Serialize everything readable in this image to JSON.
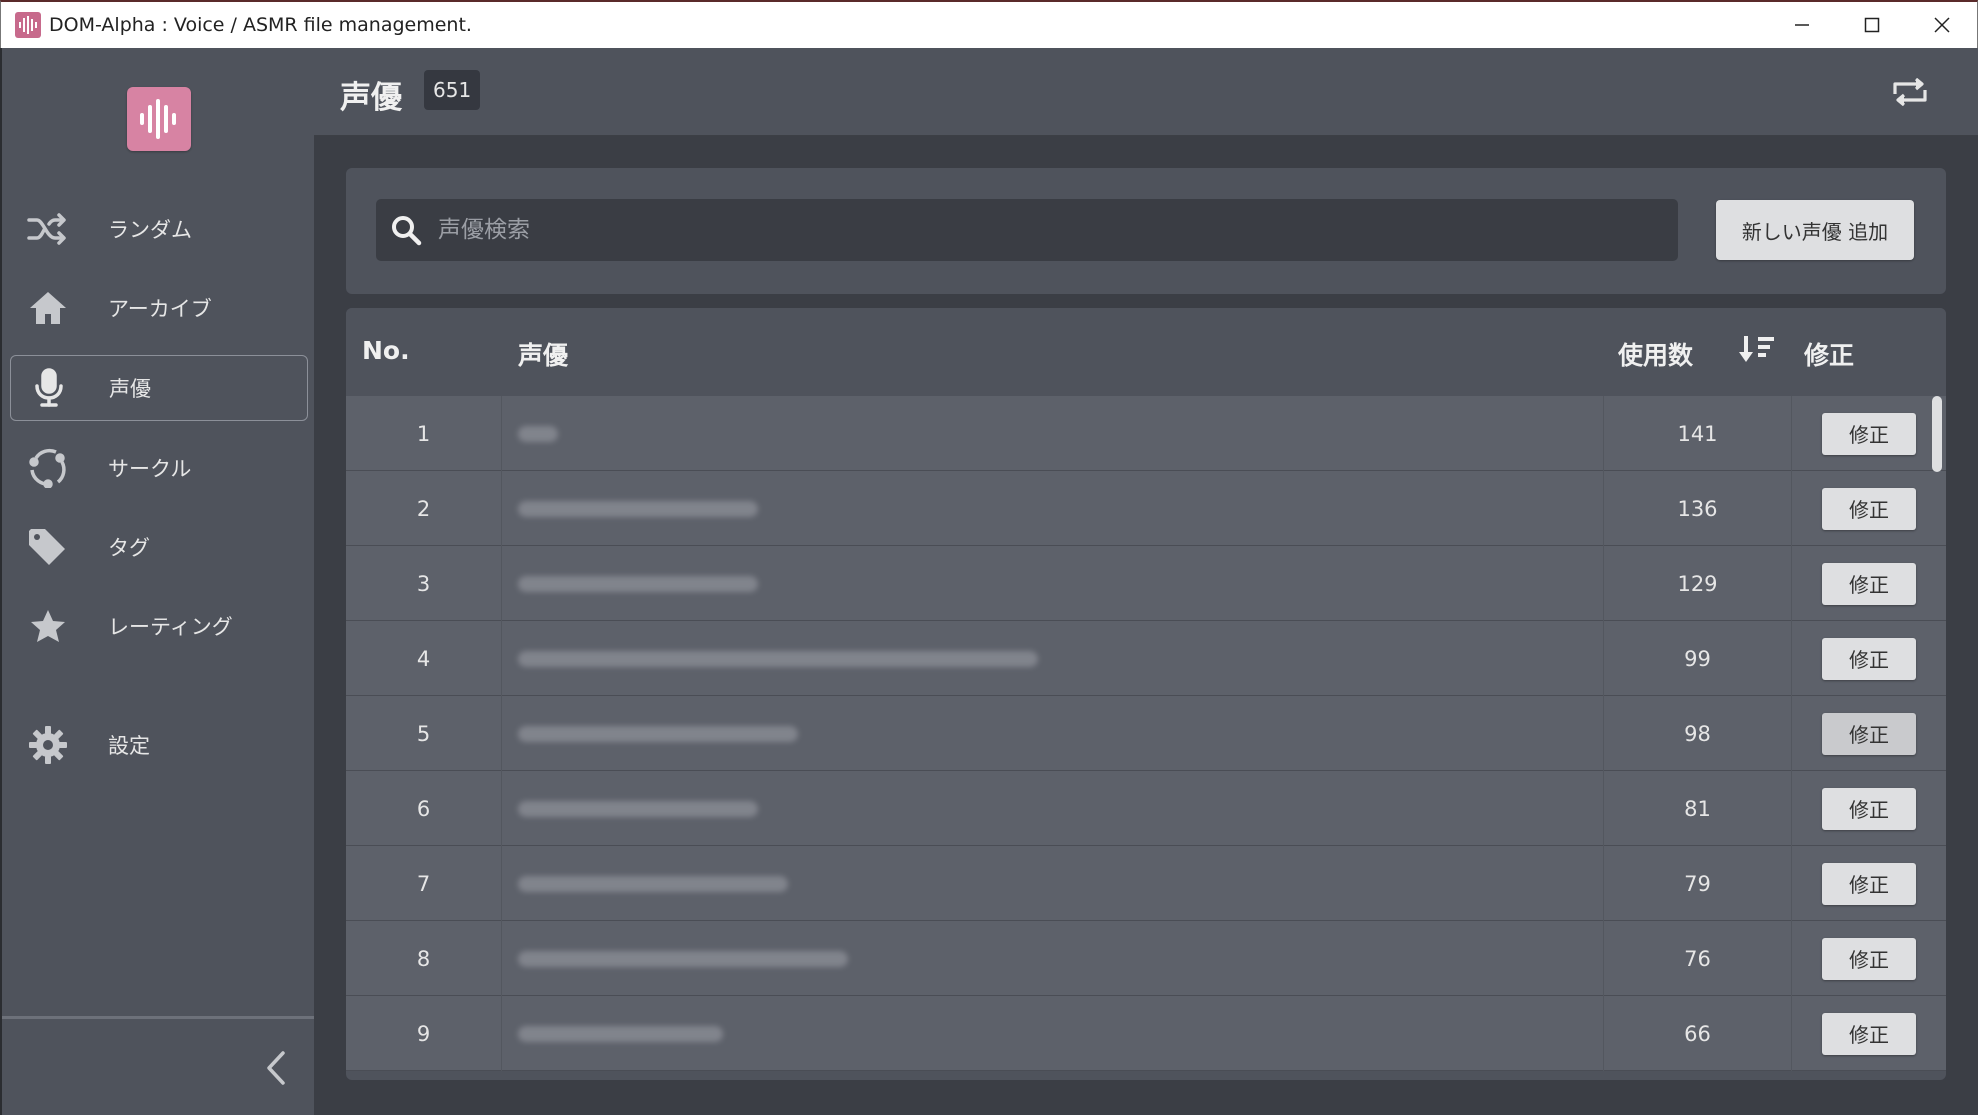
{
  "window": {
    "title": "DOM-Alpha : Voice / ASMR file management."
  },
  "sidebar": {
    "items": [
      {
        "label": "ランダム",
        "icon": "shuffle-icon"
      },
      {
        "label": "アーカイブ",
        "icon": "home-icon"
      },
      {
        "label": "声優",
        "icon": "microphone-icon",
        "active": true
      },
      {
        "label": "サークル",
        "icon": "circle-icon"
      },
      {
        "label": "タグ",
        "icon": "tag-icon"
      },
      {
        "label": "レーティング",
        "icon": "star-icon"
      },
      {
        "label": "設定",
        "icon": "gear-icon"
      }
    ]
  },
  "header": {
    "title": "声優",
    "count": "651"
  },
  "search": {
    "placeholder": "声優検索",
    "add_label": "新しい声優 追加"
  },
  "table": {
    "columns": {
      "no": "No.",
      "name": "声優",
      "count": "使用数",
      "action": "修正"
    },
    "edit_label": "修正",
    "rows": [
      {
        "no": "1",
        "count": "141"
      },
      {
        "no": "2",
        "count": "136"
      },
      {
        "no": "3",
        "count": "129"
      },
      {
        "no": "4",
        "count": "99"
      },
      {
        "no": "5",
        "count": "98"
      },
      {
        "no": "6",
        "count": "81"
      },
      {
        "no": "7",
        "count": "79"
      },
      {
        "no": "8",
        "count": "76"
      },
      {
        "no": "9",
        "count": "66"
      }
    ]
  },
  "colors": {
    "accent": "#d783a3",
    "sidebar_bg": "#4f535c",
    "main_bg": "#3b3e45",
    "row_bg": "#5d616a"
  }
}
